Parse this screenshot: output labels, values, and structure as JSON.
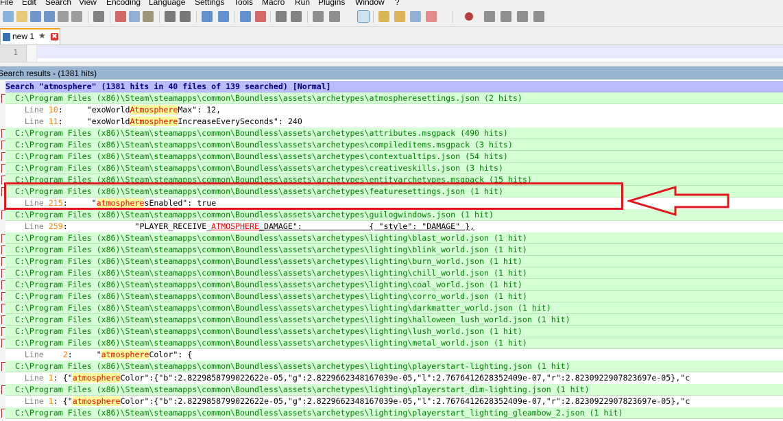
{
  "menu": {
    "items": [
      "File",
      "Edit",
      "Search",
      "View",
      "Encoding",
      "Language",
      "Settings",
      "Tools",
      "Macro",
      "Run",
      "Plugins",
      "Window",
      "?"
    ]
  },
  "toolbar": {
    "buttons": [
      "new-file",
      "open-file",
      "save",
      "save-all",
      "close",
      "close-all",
      "print",
      "cut",
      "copy",
      "paste",
      "undo",
      "redo",
      "find",
      "replace",
      "zoom-in",
      "zoom-out",
      "sync-vertical",
      "sync-horizontal",
      "word-wrap",
      "show-all-characters",
      "indent-guide",
      "document-map",
      "function-list",
      "folder-as-workspace",
      "monitoring",
      "record-macro",
      "stop-recording",
      "playback-macro",
      "run-macro-multiple",
      "save-macro"
    ]
  },
  "tab": {
    "label": "new 1",
    "pin_glyph": "★",
    "close_glyph": "✖"
  },
  "editor": {
    "line_number": "1"
  },
  "results": {
    "title": "Search results - (1381 hits)",
    "search_header": "Search \"atmosphere\" (1381 hits in 40 files of 139 searched) [Normal]",
    "rows": [
      {
        "kind": "file",
        "text": "  C:\\Program Files (x86)\\Steam\\steamapps\\common\\Boundless\\assets\\archetypes\\atmospheresettings.json (2 hits)"
      },
      {
        "kind": "line",
        "label": "    Line ",
        "num": "10",
        "pre": ":     \"exoWorld",
        "hit": "Atmosphere",
        "post": "Max\": 12,"
      },
      {
        "kind": "line",
        "label": "    Line ",
        "num": "11",
        "pre": ":     \"exoWorld",
        "hit": "Atmosphere",
        "post": "IncreaseEverySeconds\": 240"
      },
      {
        "kind": "file",
        "text": "  C:\\Program Files (x86)\\Steam\\steamapps\\common\\Boundless\\assets\\archetypes\\attributes.msgpack (490 hits)"
      },
      {
        "kind": "file",
        "text": "  C:\\Program Files (x86)\\Steam\\steamapps\\common\\Boundless\\assets\\archetypes\\compileditems.msgpack (3 hits)"
      },
      {
        "kind": "file",
        "text": "  C:\\Program Files (x86)\\Steam\\steamapps\\common\\Boundless\\assets\\archetypes\\contextualtips.json (54 hits)"
      },
      {
        "kind": "file",
        "text": "  C:\\Program Files (x86)\\Steam\\steamapps\\common\\Boundless\\assets\\archetypes\\creativeskills.json (3 hits)"
      },
      {
        "kind": "file",
        "text": "  C:\\Program Files (x86)\\Steam\\steamapps\\common\\Boundless\\assets\\archetypes\\entityarchetypes.msgpack (15 hits)"
      },
      {
        "kind": "file",
        "text": "  C:\\Program Files (x86)\\Steam\\steamapps\\common\\Boundless\\assets\\archetypes\\featuresettings.json (1 hit)"
      },
      {
        "kind": "line",
        "label": "    Line ",
        "num": "215",
        "pre": ":     \"",
        "hit": "atmosphere",
        "post": "sEnabled\": true"
      },
      {
        "kind": "file",
        "text": "  C:\\Program Files (x86)\\Steam\\steamapps\\common\\Boundless\\assets\\archetypes\\guilogwindows.json (1 hit)"
      },
      {
        "kind": "line",
        "label": "    Line ",
        "num": "259",
        "pre": ":              \"PLAYER_RECEIVE_",
        "hit": "ATMOSPHERE",
        "post": "_DAMAGE\":              { \"style\": \"DAMAGE\" },",
        "ul": true
      },
      {
        "kind": "file",
        "text": "  C:\\Program Files (x86)\\Steam\\steamapps\\common\\Boundless\\assets\\archetypes\\lighting\\blast_world.json (1 hit)"
      },
      {
        "kind": "file",
        "text": "  C:\\Program Files (x86)\\Steam\\steamapps\\common\\Boundless\\assets\\archetypes\\lighting\\blink_world.json (1 hit)"
      },
      {
        "kind": "file",
        "text": "  C:\\Program Files (x86)\\Steam\\steamapps\\common\\Boundless\\assets\\archetypes\\lighting\\burn_world.json (1 hit)"
      },
      {
        "kind": "file",
        "text": "  C:\\Program Files (x86)\\Steam\\steamapps\\common\\Boundless\\assets\\archetypes\\lighting\\chill_world.json (1 hit)"
      },
      {
        "kind": "file",
        "text": "  C:\\Program Files (x86)\\Steam\\steamapps\\common\\Boundless\\assets\\archetypes\\lighting\\coal_world.json (1 hit)"
      },
      {
        "kind": "file",
        "text": "  C:\\Program Files (x86)\\Steam\\steamapps\\common\\Boundless\\assets\\archetypes\\lighting\\corro_world.json (1 hit)"
      },
      {
        "kind": "file",
        "text": "  C:\\Program Files (x86)\\Steam\\steamapps\\common\\Boundless\\assets\\archetypes\\lighting\\darkmatter_world.json (1 hit)"
      },
      {
        "kind": "file",
        "text": "  C:\\Program Files (x86)\\Steam\\steamapps\\common\\Boundless\\assets\\archetypes\\lighting\\halloween_lush_world.json (1 hit)"
      },
      {
        "kind": "file",
        "text": "  C:\\Program Files (x86)\\Steam\\steamapps\\common\\Boundless\\assets\\archetypes\\lighting\\lush_world.json (1 hit)"
      },
      {
        "kind": "file",
        "text": "  C:\\Program Files (x86)\\Steam\\steamapps\\common\\Boundless\\assets\\archetypes\\lighting\\metal_world.json (1 hit)"
      },
      {
        "kind": "line",
        "label": "    Line ",
        "num": "   2",
        "pre": ":     \"",
        "hit": "atmosphere",
        "post": "Color\": {"
      },
      {
        "kind": "file",
        "text": "  C:\\Program Files (x86)\\Steam\\steamapps\\common\\Boundless\\assets\\archetypes\\lighting\\playerstart-lighting.json (1 hit)"
      },
      {
        "kind": "line",
        "label": "    Line ",
        "num": "1",
        "pre": ": {\"",
        "hit": "atmosphere",
        "post": "Color\":{\"b\":2.8229858799022622e-05,\"g\":2.8229662348167039e-05,\"l\":2.7676412628352409e-07,\"r\":2.8230922907823697e-05},\"c"
      },
      {
        "kind": "file",
        "text": "  C:\\Program Files (x86)\\Steam\\steamapps\\common\\Boundless\\assets\\archetypes\\lighting\\playerstart_dim-lighting.json (1 hit)"
      },
      {
        "kind": "line",
        "label": "    Line ",
        "num": "1",
        "pre": ": {\"",
        "hit": "atmosphere",
        "post": "Color\":{\"b\":2.8229858799022622e-05,\"g\":2.8229662348167039e-05,\"l\":2.7676412628352409e-07,\"r\":2.8230922907823697e-05},\"c"
      },
      {
        "kind": "file",
        "text": "  C:\\Program Files (x86)\\Steam\\steamapps\\common\\Boundless\\assets\\archetypes\\lighting\\playerstart_lighting_gleambow_2.json (1 hit)"
      }
    ]
  },
  "colors": {
    "annotation_red": "#e3141c",
    "file_row_bg": "#d5ffd5",
    "search_head_bg": "#bbbbff",
    "hit_red": "#ff0000",
    "panel_header_bg": "#99b4d1"
  }
}
